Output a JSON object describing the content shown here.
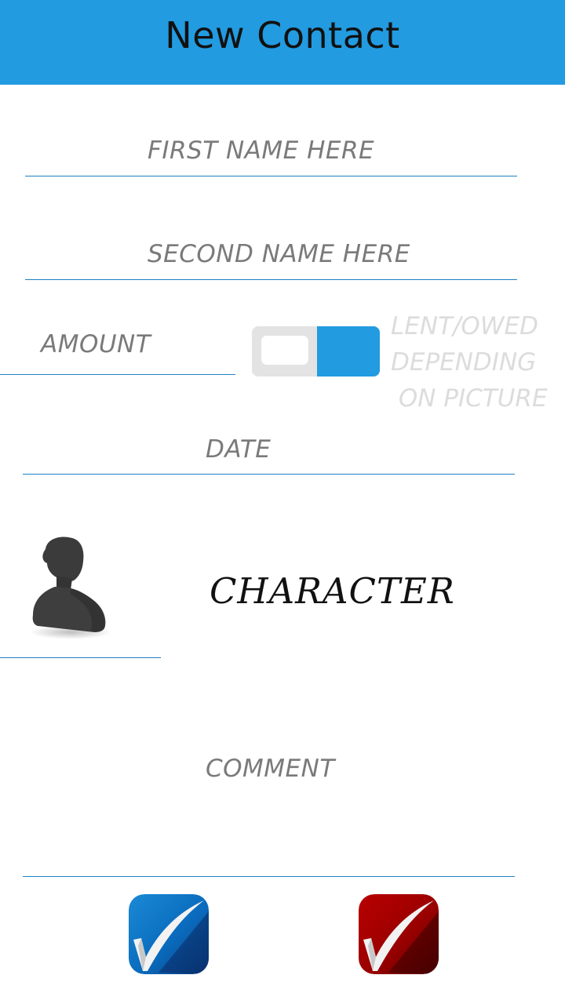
{
  "header": {
    "title": "New Contact"
  },
  "form": {
    "first_name_placeholder": "FIRST NAME HERE",
    "second_name_placeholder": "SECOND NAME HERE",
    "amount_placeholder": "AMOUNT",
    "toggle_hint": "LENT/OWED\nDEPENDING\n ON PICTURE",
    "date_placeholder": "DATE",
    "character_label": "CHARACTER",
    "comment_placeholder": "COMMENT"
  },
  "icons": {
    "avatar": "person-silhouette-icon",
    "confirm": "checkmark-icon",
    "cancel": "checkmark-icon"
  },
  "colors": {
    "accent": "#229be0",
    "underline": "#1f7fc2",
    "confirm_button": "#0a6fbf",
    "cancel_button": "#a00000",
    "placeholder_text": "#7a7a7a",
    "hint_text": "#dcdcdc"
  }
}
